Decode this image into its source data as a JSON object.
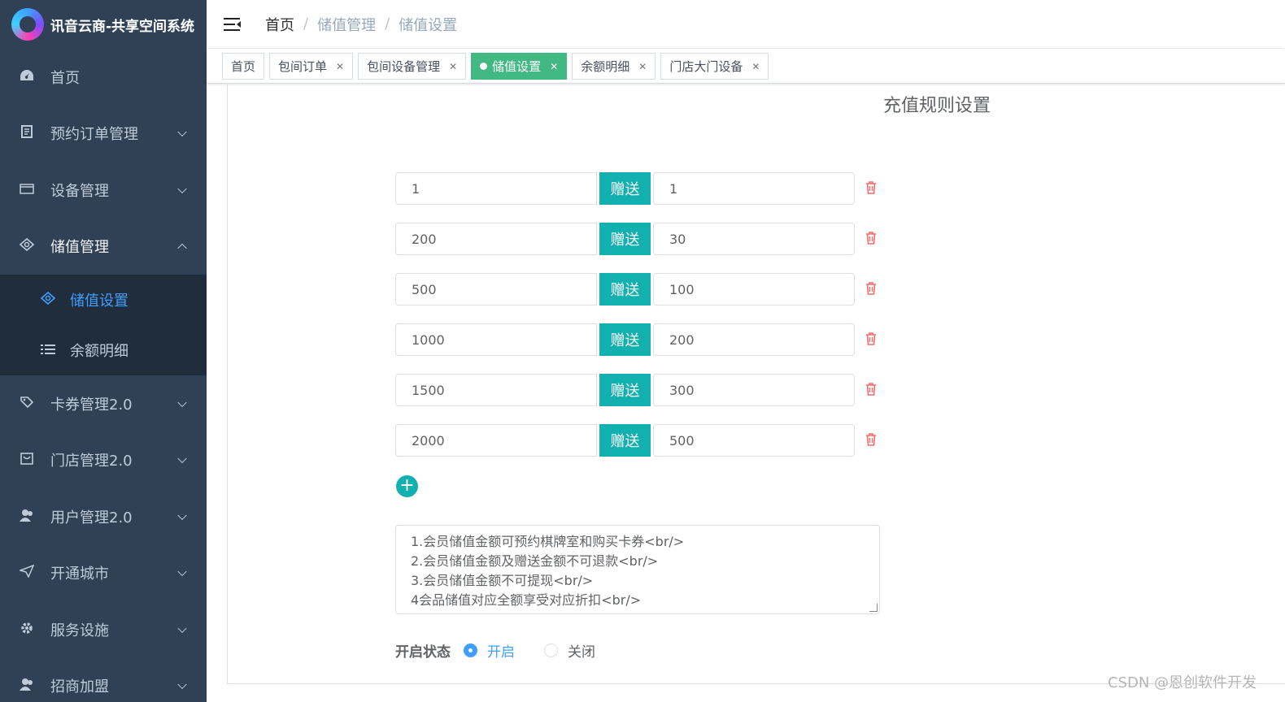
{
  "app": {
    "title": "讯音云商-共享空间系统"
  },
  "sidebar": {
    "items": [
      {
        "label": "首页",
        "icon": "dashboard-icon"
      },
      {
        "label": "预约订单管理",
        "icon": "document-icon"
      },
      {
        "label": "设备管理",
        "icon": "device-icon"
      },
      {
        "label": "储值管理",
        "icon": "wallet-icon"
      },
      {
        "label": "卡券管理2.0",
        "icon": "ticket-icon"
      },
      {
        "label": "门店管理2.0",
        "icon": "store-icon"
      },
      {
        "label": "用户管理2.0",
        "icon": "user-icon"
      },
      {
        "label": "开通城市",
        "icon": "send-icon"
      },
      {
        "label": "服务设施",
        "icon": "gear-icon"
      },
      {
        "label": "招商加盟",
        "icon": "people-icon"
      }
    ],
    "submenu": [
      {
        "label": "储值设置",
        "icon": "wallet-icon",
        "active": true
      },
      {
        "label": "余额明细",
        "icon": "list-icon",
        "active": false
      }
    ]
  },
  "breadcrumb": [
    "首页",
    "储值管理",
    "储值设置"
  ],
  "tags": [
    {
      "label": "首页",
      "closable": false
    },
    {
      "label": "包间订单",
      "closable": true
    },
    {
      "label": "包间设备管理",
      "closable": true
    },
    {
      "label": "储值设置",
      "closable": true,
      "active": true
    },
    {
      "label": "余额明细",
      "closable": true
    },
    {
      "label": "门店大门设备",
      "closable": true
    }
  ],
  "page": {
    "title": "充值规则设置",
    "gift_label": "赠送",
    "rules": [
      {
        "amount": "1",
        "gift": "1"
      },
      {
        "amount": "200",
        "gift": "30"
      },
      {
        "amount": "500",
        "gift": "100"
      },
      {
        "amount": "1000",
        "gift": "200"
      },
      {
        "amount": "1500",
        "gift": "300"
      },
      {
        "amount": "2000",
        "gift": "500"
      }
    ],
    "add_label": "+",
    "notes": [
      "1.会员储值金额可预约棋牌室和购买卡券<br/>",
      "2.会员储值金额及赠送金额不可退款<br/>",
      "3.会员储值金额不可提现<br/>",
      "4会品储值对应全额享受对应折扣<br/>"
    ],
    "status": {
      "label": "开启状态",
      "options": [
        "开启",
        "关闭"
      ],
      "selected": "开启"
    }
  },
  "watermark": "CSDN @恩创软件开发",
  "colors": {
    "sidebar_bg": "#304156",
    "submenu_bg": "#1f2d3d",
    "active_link": "#409eff",
    "tag_active": "#42b983",
    "teal": "#13b0b0",
    "danger": "#f56c6c"
  }
}
